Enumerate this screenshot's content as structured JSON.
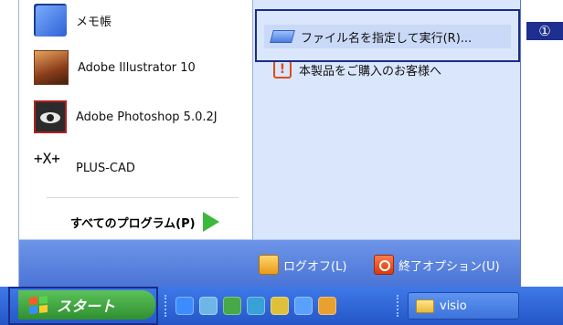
{
  "programs": [
    {
      "label": "メモ帳",
      "icon": "notepad-icon"
    },
    {
      "label": "Adobe Illustrator 10",
      "icon": "illustrator-icon"
    },
    {
      "label": "Adobe Photoshop 5.0.2J",
      "icon": "photoshop-icon"
    },
    {
      "label": "PLUS-CAD",
      "icon": "plus-cad-icon",
      "icon_text": "+X+"
    }
  ],
  "all_programs": {
    "label": "すべてのプログラム(P)",
    "icon": "green-arrow-icon"
  },
  "right_pane": {
    "run": {
      "label": "ファイル名を指定して実行(R)...",
      "icon": "run-icon"
    },
    "purchase": {
      "label": "本製品をご購入のお客様へ",
      "icon": "warning-icon",
      "icon_text": "!"
    }
  },
  "bottom": {
    "logoff": {
      "label": "ログオフ(L)",
      "icon": "logoff-key-icon"
    },
    "shutdown": {
      "label": "終了オプション(U)",
      "icon": "power-icon"
    }
  },
  "taskbar": {
    "start_label": "スタート",
    "quick_launch": [
      "ie-icon",
      "outlook-icon",
      "desktop-icon",
      "media-icon",
      "app-icon",
      "ie2-icon",
      "misc-icon"
    ],
    "task_button": {
      "label": "visio",
      "icon": "folder-icon"
    }
  },
  "callout": {
    "label": "①"
  },
  "colors": {
    "highlight_border": "#1a2c8a",
    "taskbar": "#2456c7",
    "start_button": "#3aa63a",
    "right_pane": "#d9e6fb"
  }
}
